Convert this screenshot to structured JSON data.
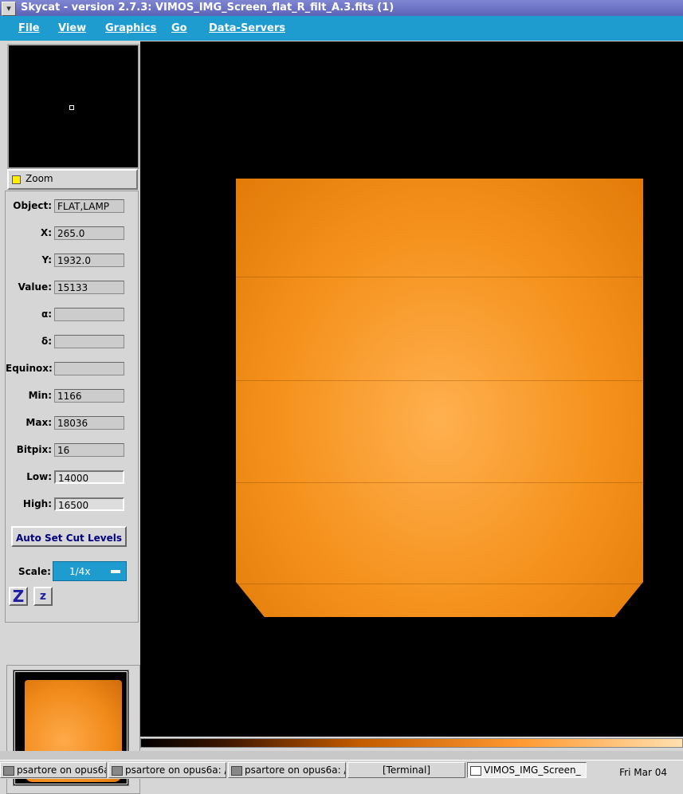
{
  "window": {
    "title": "Skycat - version 2.7.3: VIMOS_IMG_Screen_flat_R_filt_A.3.fits (1)"
  },
  "menu": [
    "File",
    "View",
    "Graphics",
    "Go",
    "Data-Servers"
  ],
  "zoom": {
    "label": "Zoom"
  },
  "info": {
    "object": {
      "label": "Object:",
      "value": "FLAT,LAMP"
    },
    "x": {
      "label": "X:",
      "value": "265.0"
    },
    "y": {
      "label": "Y:",
      "value": "1932.0"
    },
    "value": {
      "label": "Value:",
      "value": "15133"
    },
    "alpha": {
      "label": "α:",
      "value": ""
    },
    "delta": {
      "label": "δ:",
      "value": ""
    },
    "equinox": {
      "label": "Equinox:",
      "value": ""
    },
    "min": {
      "label": "Min:",
      "value": "1166"
    },
    "max": {
      "label": "Max:",
      "value": "18036"
    },
    "bitpix": {
      "label": "Bitpix:",
      "value": "16"
    },
    "low": {
      "label": "Low:",
      "value": "14000"
    },
    "high": {
      "label": "High:",
      "value": "16500"
    }
  },
  "auto_cut": "Auto Set Cut Levels",
  "scale": {
    "label": "Scale:",
    "value": "1/4x"
  },
  "zoom_buttons": [
    "Z",
    "z"
  ],
  "taskbar": {
    "tasks": [
      "psartore on opus6a: /",
      "psartore on opus6a: /h",
      "psartore on opus6a: /",
      "[Terminal]",
      "VIMOS_IMG_Screen_"
    ],
    "clock": "Fri Mar 04"
  },
  "colors": {
    "menubar": "#1e9cd0",
    "titlebar": "#5c63b8",
    "image": "#f5921d"
  }
}
